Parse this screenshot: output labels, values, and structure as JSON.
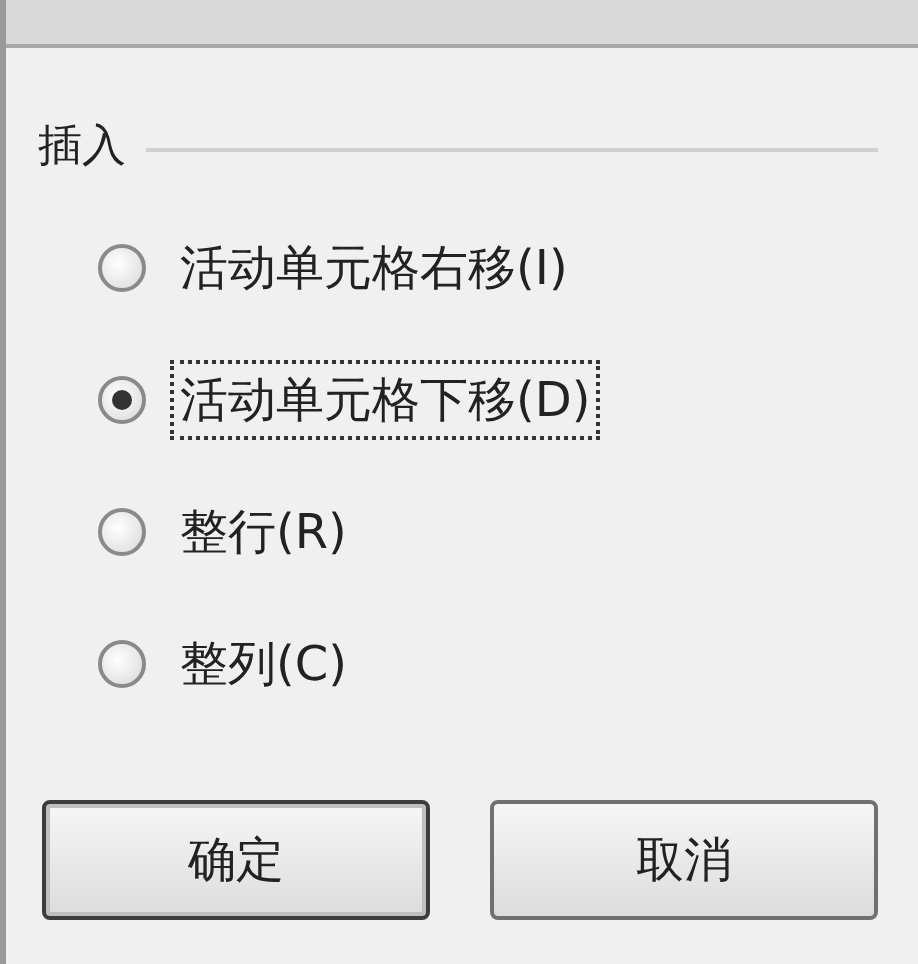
{
  "group": {
    "title": "插入"
  },
  "options": [
    {
      "label": "活动单元格右移(I)",
      "selected": false
    },
    {
      "label": "活动单元格下移(D)",
      "selected": true
    },
    {
      "label": "整行(R)",
      "selected": false
    },
    {
      "label": "整列(C)",
      "selected": false
    }
  ],
  "buttons": [
    "确定",
    "取消"
  ]
}
